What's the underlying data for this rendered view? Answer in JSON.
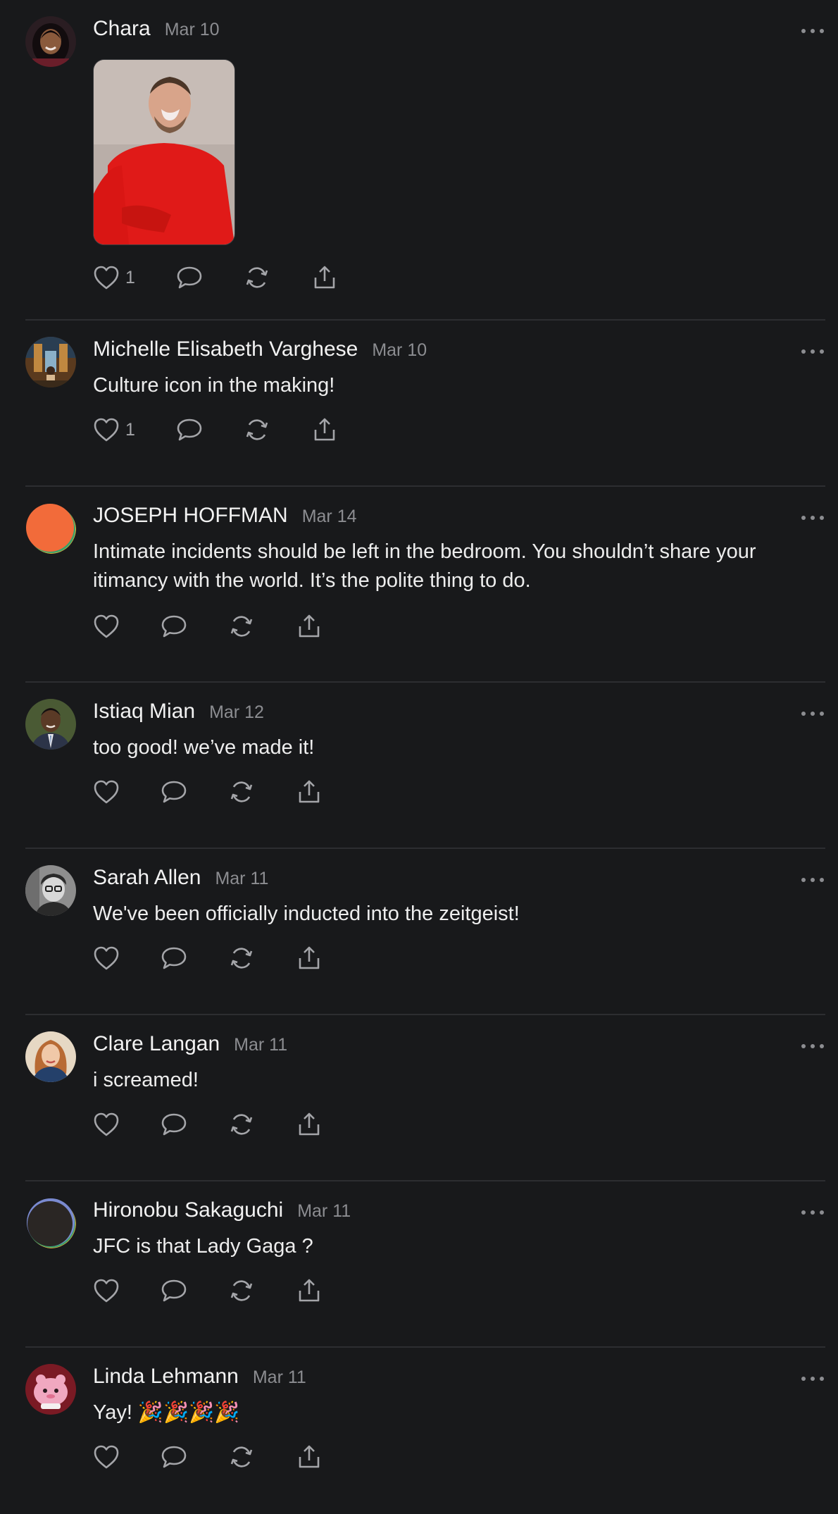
{
  "posts": [
    {
      "author": "Chara",
      "date": "Mar 10",
      "text": "",
      "has_media": true,
      "likes": "1",
      "avatar_color": "#3a2a2a"
    },
    {
      "author": "Michelle Elisabeth Varghese",
      "date": "Mar 10",
      "text": "Culture icon in the making!",
      "likes": "1",
      "avatar_color": "#7a4a2a"
    },
    {
      "author": "JOSEPH HOFFMAN",
      "date": "Mar 14",
      "text": "Intimate incidents should be left in the bedroom. You shouldn’t share your itimancy with the world. It’s the polite thing to do.",
      "likes": "",
      "avatar_color": "#f26b3a"
    },
    {
      "author": "Istiaq Mian",
      "date": "Mar 12",
      "text": "too good! we’ve made it!",
      "likes": "",
      "avatar_color": "#3b4a2e"
    },
    {
      "author": "Sarah Allen",
      "date": "Mar 11",
      "text": "We've been officially inducted into the zeitgeist!",
      "likes": "",
      "avatar_color": "#9a9a9a"
    },
    {
      "author": "Clare Langan",
      "date": "Mar 11",
      "text": "i screamed!",
      "likes": "",
      "avatar_color": "#d9c3a5"
    },
    {
      "author": "Hironobu Sakaguchi",
      "date": "Mar 11",
      "text": "JFC is that Lady Gaga ?",
      "likes": "",
      "avatar_color": "#2a2624"
    },
    {
      "author": "Linda Lehmann",
      "date": "Mar 11",
      "text": "Yay! 🎉🎉🎉🎉",
      "likes": "",
      "avatar_color": "#7a1a24"
    }
  ],
  "icons": {
    "like": "heart-icon",
    "reply": "comment-icon",
    "repost": "repost-icon",
    "share": "share-icon",
    "more": "more-icon"
  },
  "colors": {
    "background": "#18191b",
    "divider": "#2d2e31",
    "secondary_text": "#8c8d91",
    "icon": "#a4a5a9"
  }
}
